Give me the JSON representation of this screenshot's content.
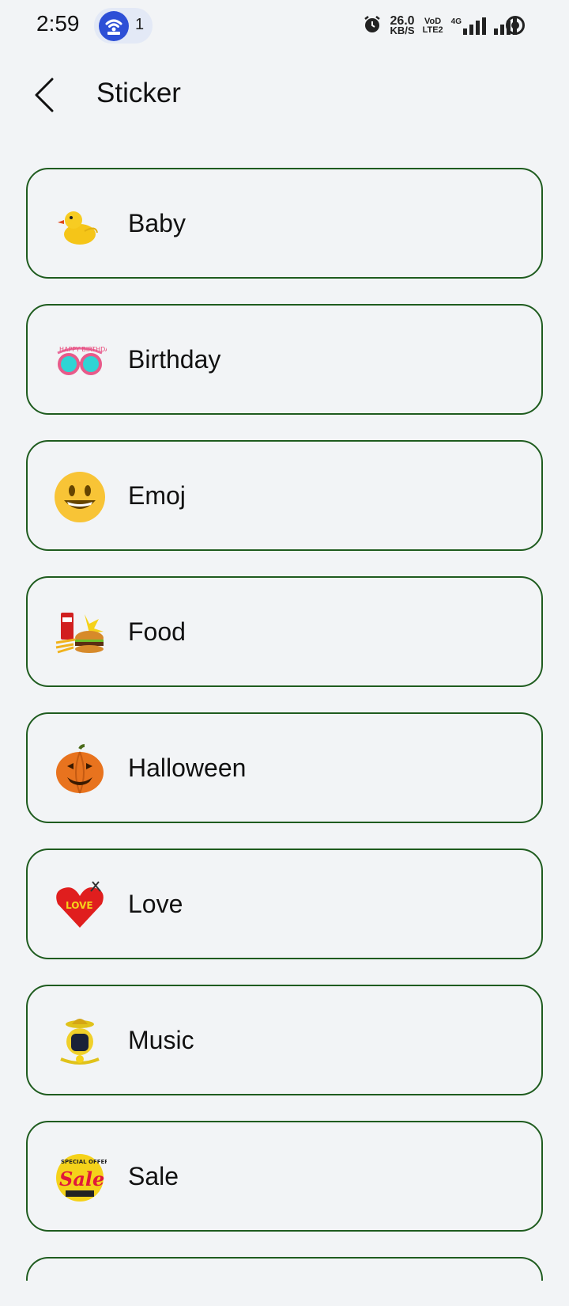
{
  "status_bar": {
    "time": "2:59",
    "notification_count": "1",
    "net_speed_value": "26.0",
    "net_speed_unit": "KB/S",
    "volte_top": "VoD",
    "volte_bottom": "LTE2",
    "network_type": "4G"
  },
  "header": {
    "title": "Sticker",
    "back_icon": "back-arrow-icon"
  },
  "categories": [
    {
      "label": "Baby",
      "icon": "rubber-duck-icon"
    },
    {
      "label": "Birthday",
      "icon": "birthday-glasses-icon"
    },
    {
      "label": "Emoj",
      "icon": "smiley-face-icon"
    },
    {
      "label": "Food",
      "icon": "burger-fries-icon"
    },
    {
      "label": "Halloween",
      "icon": "pumpkin-icon"
    },
    {
      "label": "Love",
      "icon": "heart-love-icon"
    },
    {
      "label": "Music",
      "icon": "music-character-icon"
    },
    {
      "label": "Sale",
      "icon": "sale-badge-icon"
    }
  ],
  "colors": {
    "background": "#f2f4f6",
    "card_border": "#1f5c1f",
    "accent_blue": "#2d4fd6"
  }
}
